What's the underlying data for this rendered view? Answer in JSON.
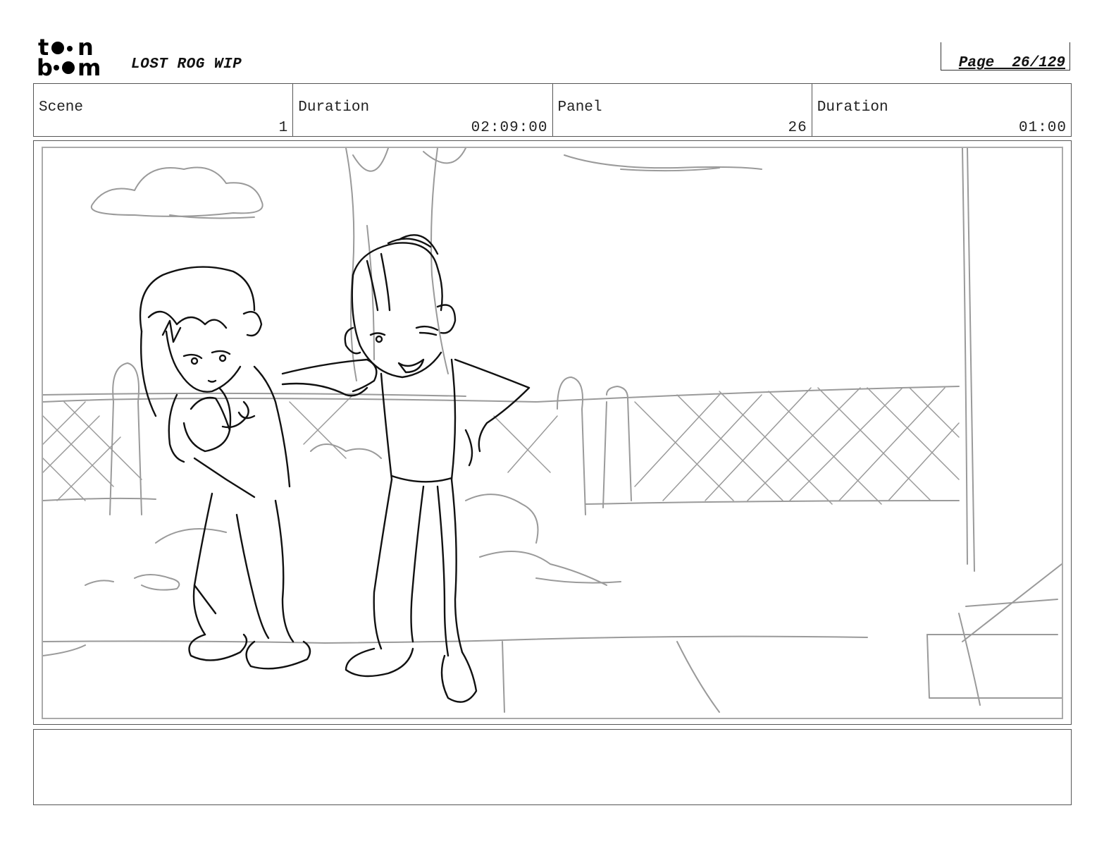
{
  "header": {
    "logo_top": "t•n",
    "logo_bottom": "b•m",
    "project_title": "LOST ROG WIP",
    "page_label": "Page  26/129"
  },
  "info": {
    "scene_label": "Scene",
    "scene_value": "1",
    "scene_duration_label": "Duration",
    "scene_duration_value": "02:09:00",
    "panel_label": "Panel",
    "panel_value": "26",
    "panel_duration_label": "Duration",
    "panel_duration_value": "01:00"
  },
  "notes": {
    "text": ""
  },
  "colors": {
    "border": "#555555",
    "sketch": "#111111",
    "background_sketch": "#9a9a9a"
  }
}
